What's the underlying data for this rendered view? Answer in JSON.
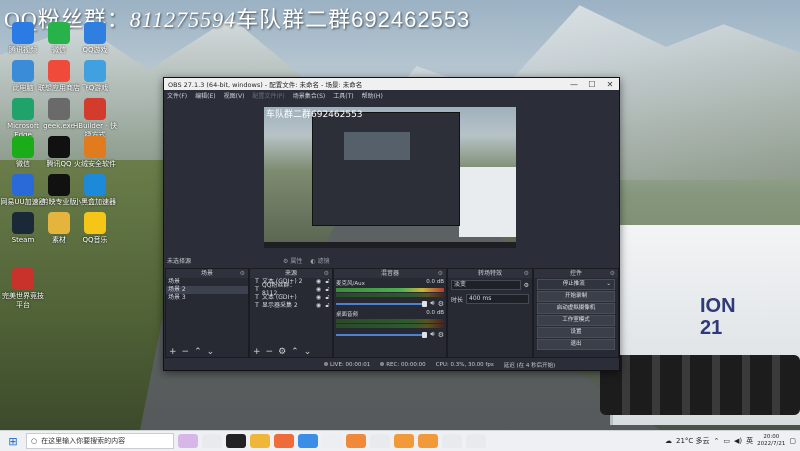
{
  "watermark": {
    "qq_label": "QQ粉丝群：",
    "qq_number": "811275594",
    "fleet_label": "车队群二群",
    "fleet_number": "692462553"
  },
  "desktop_icons": [
    {
      "label": "腾讯视频",
      "icon": "video-icon",
      "color": "#2b7be4"
    },
    {
      "label": "微信",
      "icon": "wechat-icon",
      "color": "#27b34a"
    },
    {
      "label": "QQ游戏",
      "icon": "game-icon",
      "color": "#2f7fe0"
    },
    {
      "label": "此电脑",
      "icon": "computer-icon",
      "color": "#3a8bd8"
    },
    {
      "label": "联想应用商店",
      "icon": "store-icon",
      "color": "#ef4a3a"
    },
    {
      "label": "飞Q游戏",
      "icon": "plane-icon",
      "color": "#40a0e0"
    },
    {
      "label": "Microsoft Edge",
      "icon": "edge-icon",
      "color": "#1fa36a"
    },
    {
      "label": "geek.exe",
      "icon": "geek-icon",
      "color": "#6a6a6a"
    },
    {
      "label": "HBuilder - 快捷方式",
      "icon": "hbuilder-icon",
      "color": "#d33b2c"
    },
    {
      "label": "微信",
      "icon": "wechat2-icon",
      "color": "#1aad19"
    },
    {
      "label": "腾讯QQ",
      "icon": "qq-icon",
      "color": "#111111"
    },
    {
      "label": "火绒安全软件",
      "icon": "shield-icon",
      "color": "#e07b1e"
    },
    {
      "label": "网易UU加速器",
      "icon": "uu-icon",
      "color": "#2a6ad8"
    },
    {
      "label": "剪映专业版",
      "icon": "capcut-icon",
      "color": "#111111"
    },
    {
      "label": "小黑盒加速器",
      "icon": "heybox-icon",
      "color": "#1c8ad8"
    },
    {
      "label": "Steam",
      "icon": "steam-icon",
      "color": "#1b2838"
    },
    {
      "label": "素材",
      "icon": "folder-icon",
      "color": "#e5b43c"
    },
    {
      "label": "QQ音乐",
      "icon": "music-icon",
      "color": "#f5c518"
    },
    {
      "label": "完美世界竞技平台",
      "icon": "perfect-icon",
      "color": "#c8322b"
    }
  ],
  "obs": {
    "title": "OBS 27.1.3 (64-bit, windows) - 配置文件: 未命名 - 场景: 未命名",
    "menu": [
      "文件(F)",
      "编辑(E)",
      "视图(V)",
      "配置文件(P)",
      "场景集合(S)",
      "工具(T)",
      "帮助(H)"
    ],
    "preview_text": "车队群二群692462553",
    "no_source_selected": "未选择源",
    "props_button": "属性",
    "filters_button": "滤镜",
    "docks": {
      "scenes": {
        "title": "场景",
        "items": [
          "场景",
          "场景 2",
          "场景 3"
        ],
        "selected": 1
      },
      "sources": {
        "title": "来源",
        "items": [
          "文本 (GDI+) 2",
          "QQ粉丝群：8112…",
          "文本 (GDI+)",
          "显示器采集 2"
        ]
      },
      "mixer": {
        "title": "混音器",
        "channels": [
          {
            "name": "麦克风/Aux",
            "db": "0.0 dB"
          },
          {
            "name": "桌面音频",
            "db": "0.0 dB"
          }
        ]
      },
      "transitions": {
        "title": "转场特效",
        "type": "淡变",
        "duration_label": "时长",
        "duration": "400 ms"
      },
      "controls": {
        "title": "控件",
        "buttons": [
          "停止推流",
          "开始录制",
          "启动虚拟摄像机",
          "工作室模式",
          "设置",
          "退出"
        ]
      }
    },
    "status": {
      "live": "LIVE: 00:00:01",
      "rec": "REC: 00:00:00",
      "cpu": "CPU: 0.3%, 30.00 fps",
      "dropped": "延迟 (在 4 秒后开始)"
    }
  },
  "taskbar": {
    "search_placeholder": "在这里输入你要搜索的内容",
    "weather": "21°C 多云",
    "lang": "英",
    "time": "20:00",
    "date": "2022/7/21"
  },
  "truck_text": "ION\n21"
}
